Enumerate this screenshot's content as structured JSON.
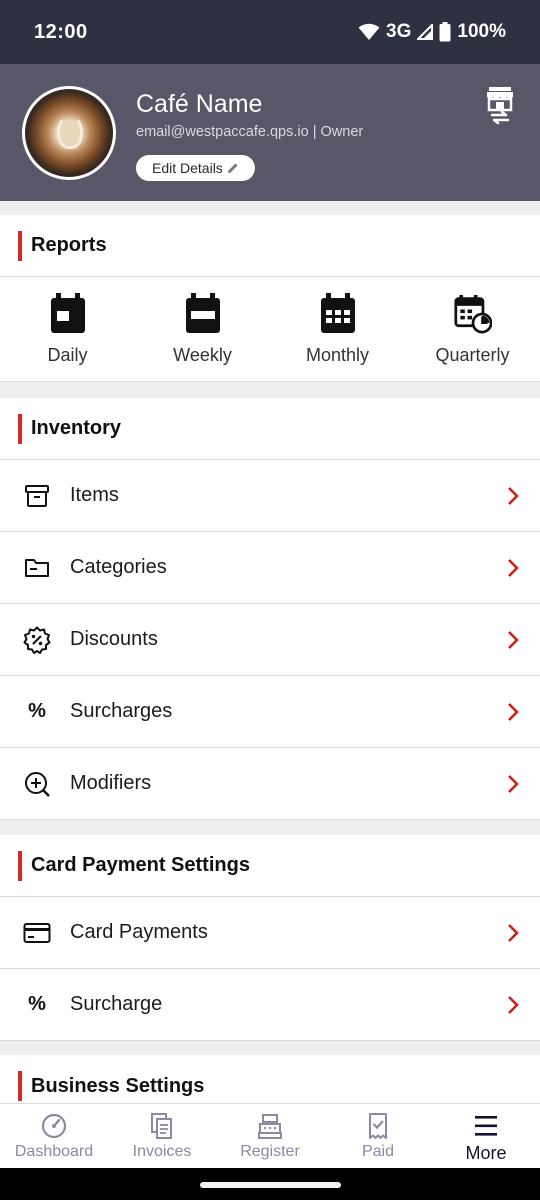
{
  "status_bar": {
    "time": "12:00",
    "network": "3G",
    "battery": "100%"
  },
  "header": {
    "cafe_name": "Café Name",
    "email_role": "email@westpaccafe.qps.io | Owner",
    "edit_label": "Edit Details",
    "background_color": "#575767"
  },
  "reports": {
    "title": "Reports",
    "items": [
      {
        "label": "Daily",
        "icon": "calendar-day-icon"
      },
      {
        "label": "Weekly",
        "icon": "calendar-week-icon"
      },
      {
        "label": "Monthly",
        "icon": "calendar-month-icon"
      },
      {
        "label": "Quarterly",
        "icon": "calendar-clock-icon"
      }
    ]
  },
  "inventory": {
    "title": "Inventory",
    "items": [
      {
        "label": "Items",
        "icon": "box-icon"
      },
      {
        "label": "Categories",
        "icon": "folder-icon"
      },
      {
        "label": "Discounts",
        "icon": "discount-badge-icon"
      },
      {
        "label": "Surcharges",
        "icon": "percent-icon"
      },
      {
        "label": "Modifiers",
        "icon": "zoom-plus-icon"
      }
    ]
  },
  "card_payment_settings": {
    "title": "Card Payment Settings",
    "items": [
      {
        "label": "Card Payments",
        "icon": "credit-card-icon"
      },
      {
        "label": "Surcharge",
        "icon": "percent-icon"
      }
    ]
  },
  "business_settings": {
    "title": "Business Settings"
  },
  "bottom_nav": {
    "items": [
      {
        "label": "Dashboard",
        "icon": "gauge-icon"
      },
      {
        "label": "Invoices",
        "icon": "documents-icon"
      },
      {
        "label": "Register",
        "icon": "cash-register-icon"
      },
      {
        "label": "Paid",
        "icon": "receipt-check-icon"
      },
      {
        "label": "More",
        "icon": "hamburger-menu-icon"
      }
    ],
    "active": "More"
  },
  "colors": {
    "accent": "#d42a25",
    "status_bar": "#2e3140",
    "nav_active": "#141432",
    "nav_inactive": "#8a8aa0"
  }
}
